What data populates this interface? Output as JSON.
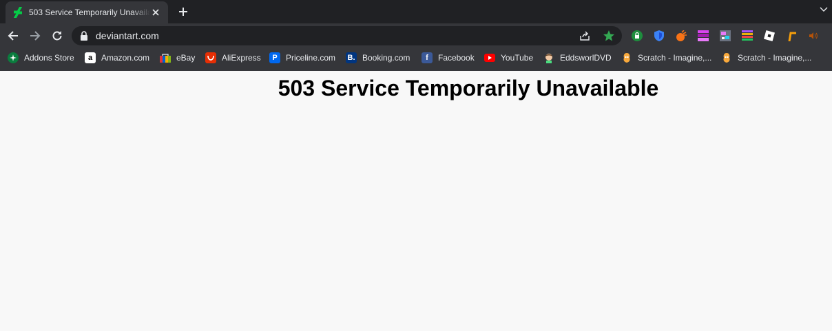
{
  "browser": {
    "tab": {
      "title": "503 Service Temporarily Unavailable",
      "favicon": "deviantart-logo-icon"
    },
    "url": "deviantart.com",
    "accent_colors": {
      "deviantart_green": "#05cc47",
      "star_green": "#34a853"
    }
  },
  "bookmarks": [
    {
      "label": "Addons Store",
      "icon": "addons-store-icon"
    },
    {
      "label": "Amazon.com",
      "icon": "amazon-icon"
    },
    {
      "label": "eBay",
      "icon": "ebay-icon"
    },
    {
      "label": "AliExpress",
      "icon": "aliexpress-icon"
    },
    {
      "label": "Priceline.com",
      "icon": "priceline-icon"
    },
    {
      "label": "Booking.com",
      "icon": "booking-icon"
    },
    {
      "label": "Facebook",
      "icon": "facebook-icon"
    },
    {
      "label": "YouTube",
      "icon": "youtube-icon"
    },
    {
      "label": "EddsworlDVD",
      "icon": "eddsworld-icon"
    },
    {
      "label": "Scratch - Imagine,...",
      "icon": "scratch-icon"
    },
    {
      "label": "Scratch - Imagine,...",
      "icon": "scratch-icon"
    }
  ],
  "page": {
    "heading": "503 Service Temporarily Unavailable"
  }
}
